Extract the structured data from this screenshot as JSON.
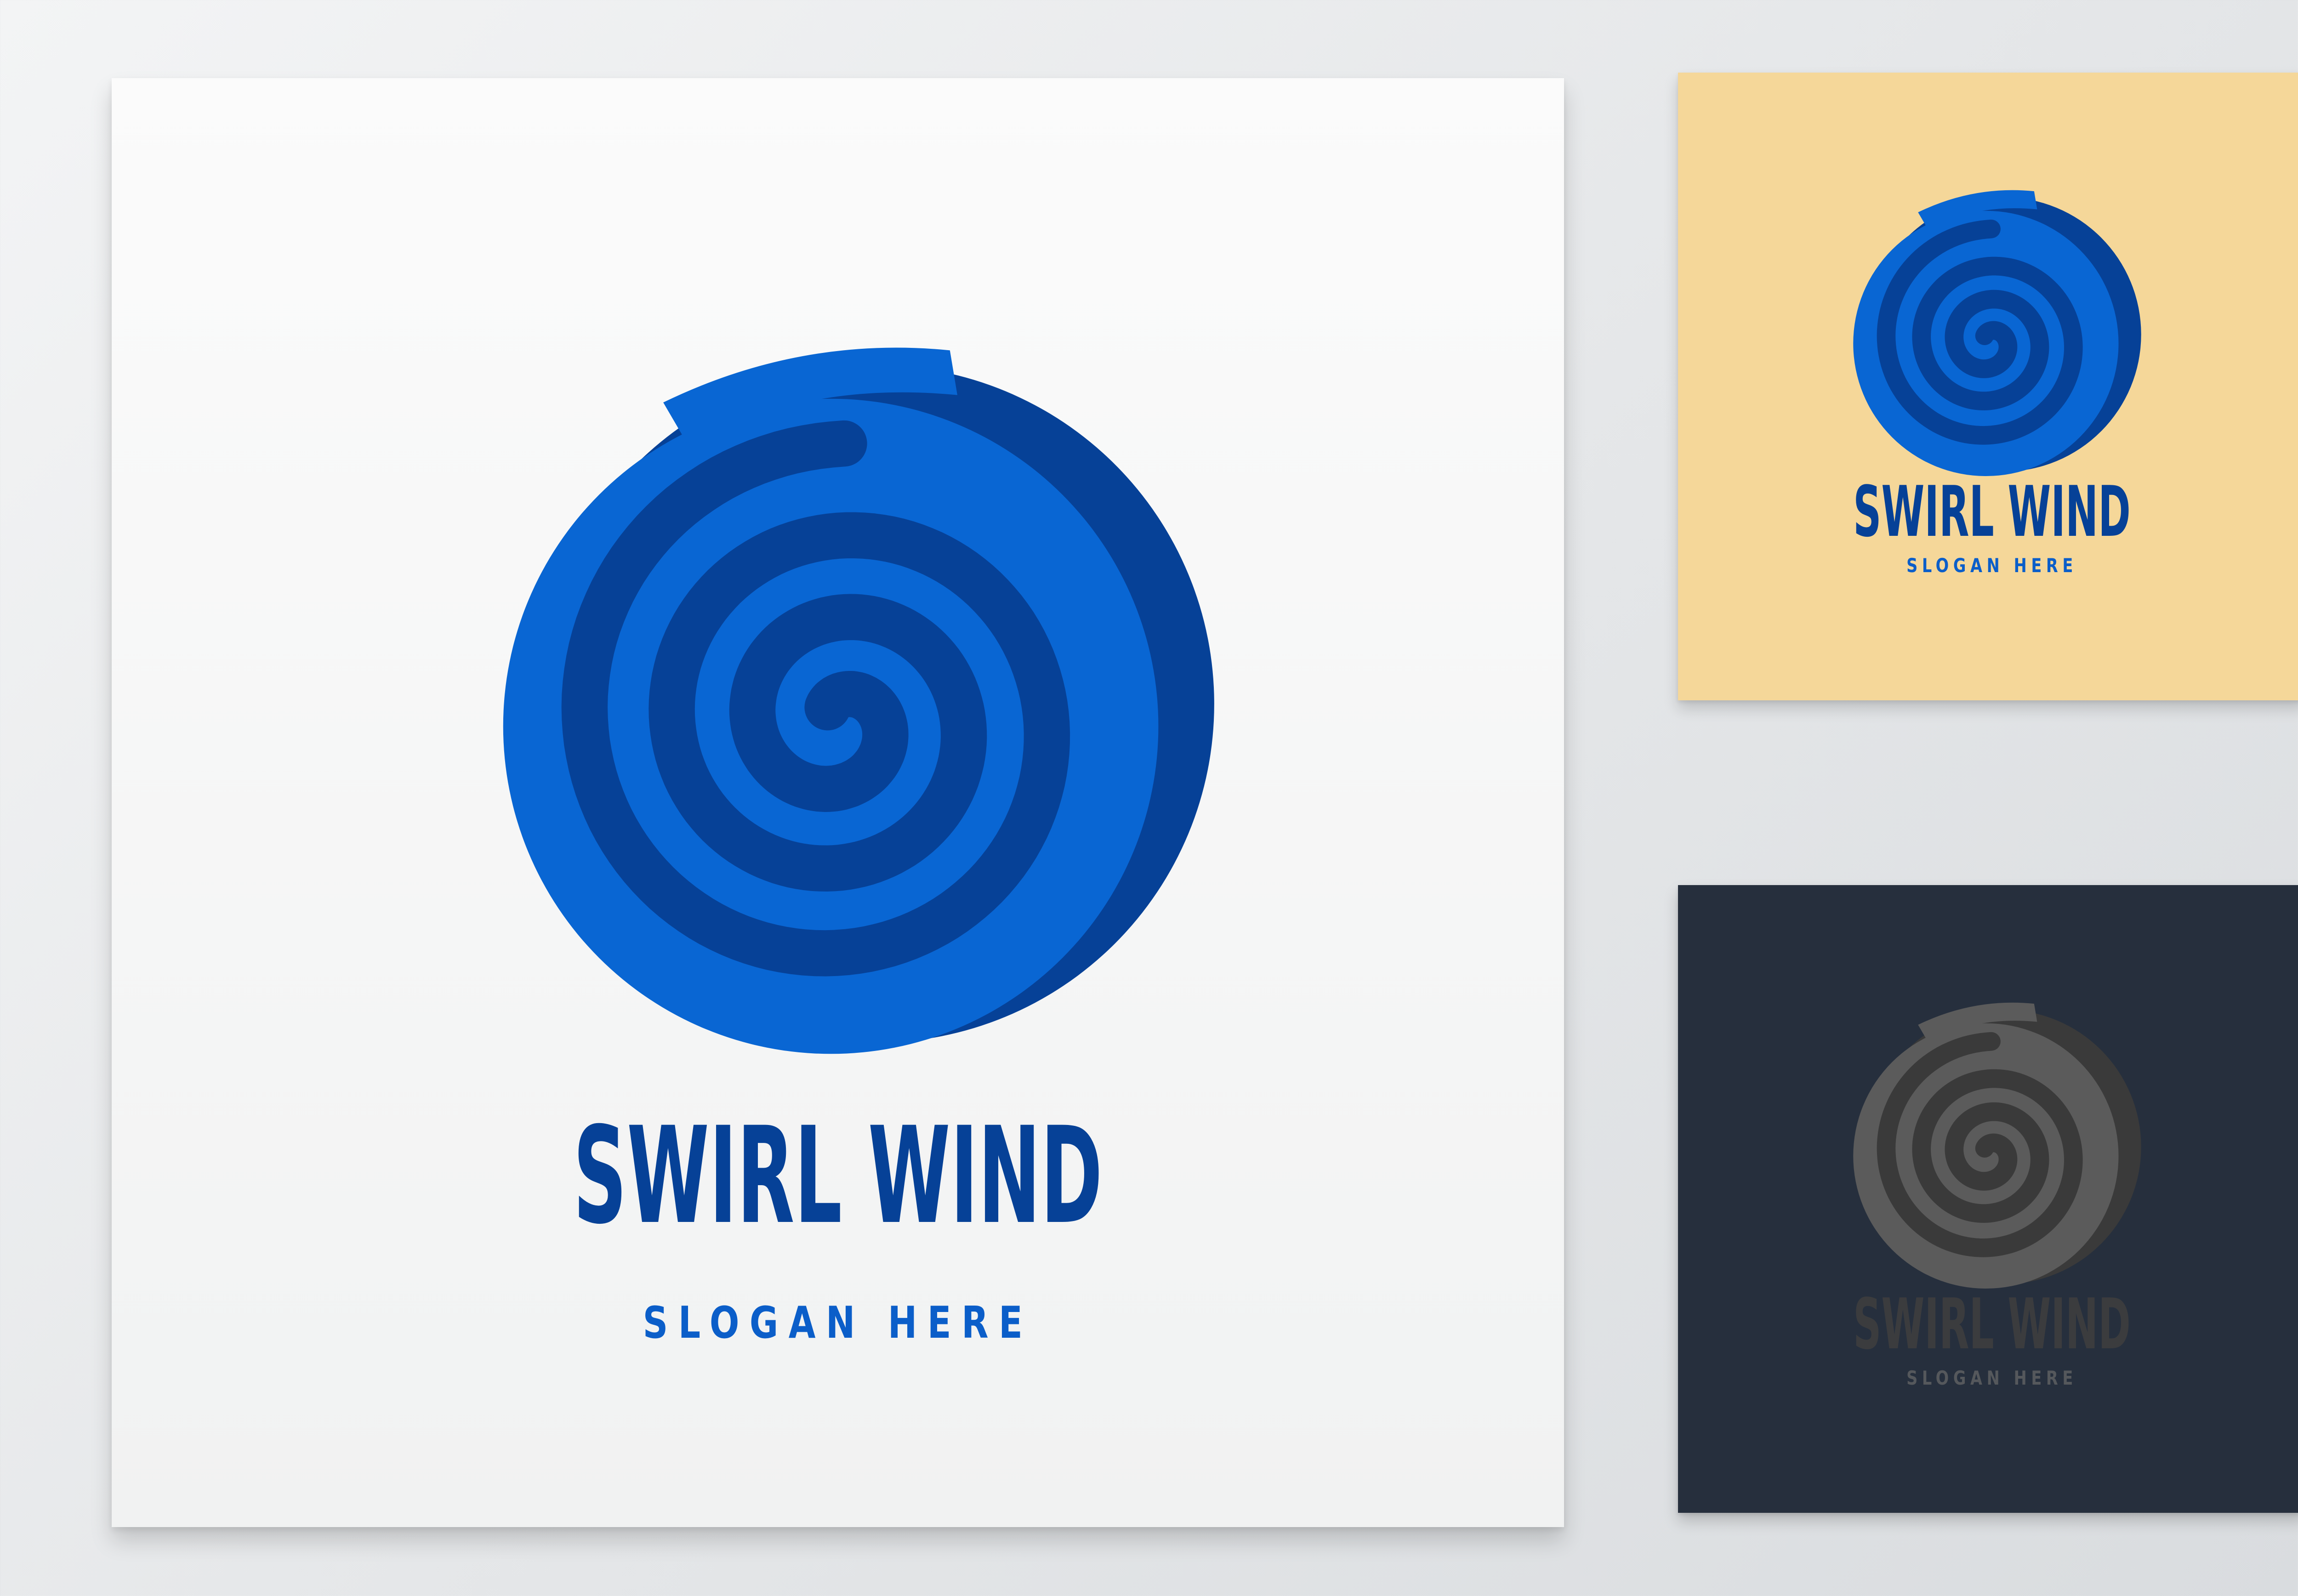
{
  "cards": {
    "main": {
      "title": "SWIRL WIND",
      "slogan": "SLOGAN HERE",
      "background": "#f6f7f7",
      "primary": "#0966d3",
      "dark": "#064197"
    },
    "cream": {
      "title": "SWIRL WIND",
      "slogan": "SLOGAN HERE",
      "background": "#f5d799",
      "primary": "#0966d3",
      "dark": "#064197"
    },
    "navy": {
      "title": "SWIRL WIND",
      "slogan": "SLOGAN HERE",
      "background": "#262f3d",
      "primary": "#5b5b5b",
      "dark": "#3a3a3a"
    }
  },
  "icons": {
    "logo": "swirl-spiral-icon"
  }
}
